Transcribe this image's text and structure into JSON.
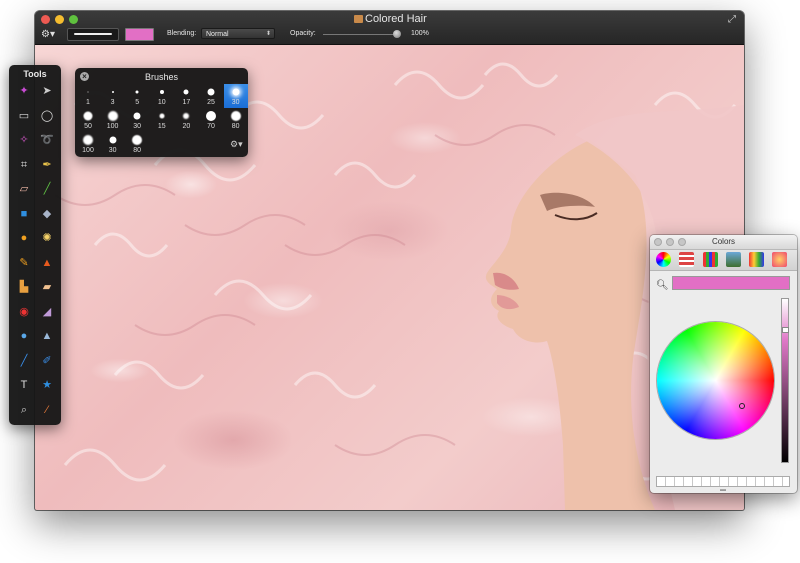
{
  "window": {
    "title": "Colored Hair"
  },
  "toolbar": {
    "blending_label": "Blending:",
    "blending_value": "Normal",
    "opacity_label": "Opacity:",
    "opacity_value": "100%",
    "opacity_fraction": 1.0,
    "current_color": "#e26fc5"
  },
  "tools_panel": {
    "title": "Tools",
    "tools": [
      "magic-wand-icon",
      "pointer-arrow-icon",
      "rect-select-icon",
      "ellipse-select-icon",
      "magic-selection-icon",
      "lasso-icon",
      "crop-icon",
      "eyedropper-icon",
      "eraser-icon",
      "brush-icon",
      "rectangle-shape-icon",
      "paint-bucket-icon",
      "ellipse-shape-icon",
      "color-wheel-icon",
      "paintbrush-icon",
      "burn-flame-icon",
      "clone-stamp-icon",
      "bandage-icon",
      "red-eye-icon",
      "smudge-icon",
      "blur-drop-icon",
      "sharpen-icon",
      "pen-line-icon",
      "pen-icon",
      "text-icon",
      "star-shape-icon",
      "zoom-icon",
      "color-picker-icon"
    ]
  },
  "brushes_panel": {
    "title": "Brushes",
    "brushes": [
      {
        "size": "1",
        "selected": false
      },
      {
        "size": "3",
        "selected": false
      },
      {
        "size": "5",
        "selected": false
      },
      {
        "size": "10",
        "selected": false
      },
      {
        "size": "17",
        "selected": false
      },
      {
        "size": "25",
        "selected": false
      },
      {
        "size": "30",
        "selected": true
      },
      {
        "size": "50",
        "selected": false
      },
      {
        "size": "100",
        "selected": false
      },
      {
        "size": "30",
        "selected": false
      },
      {
        "size": "15",
        "selected": false
      },
      {
        "size": "20",
        "selected": false
      },
      {
        "size": "70",
        "selected": false
      },
      {
        "size": "80",
        "selected": false
      },
      {
        "size": "100",
        "selected": false
      },
      {
        "size": "30",
        "selected": false
      },
      {
        "size": "80",
        "selected": false
      }
    ]
  },
  "colors_panel": {
    "title": "Colors",
    "selected_color": "#e26fc5",
    "modes": [
      "color-wheel-icon",
      "color-sliders-icon",
      "color-palettes-icon",
      "image-palettes-icon",
      "crayons-icon",
      "pencils-icon"
    ]
  }
}
